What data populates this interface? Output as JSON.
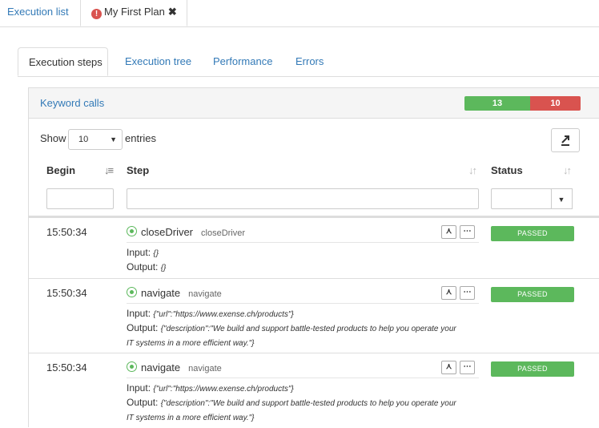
{
  "top_tabs": [
    {
      "label": "Execution list"
    },
    {
      "label": "My First Plan",
      "close": "✖"
    }
  ],
  "sub_tabs": [
    {
      "label": "Execution steps"
    },
    {
      "label": "Execution tree"
    },
    {
      "label": "Performance"
    },
    {
      "label": "Errors"
    }
  ],
  "panel": {
    "title": "Keyword calls",
    "passed_count": "13",
    "failed_count": "10",
    "show_label": "Show",
    "entries_value": "10",
    "entries_label": "entries"
  },
  "columns": {
    "begin": "Begin",
    "step": "Step",
    "status": "Status"
  },
  "rows": [
    {
      "time": "15:50:34",
      "name": "closeDriver",
      "sub": "closeDriver",
      "input_label": "Input:",
      "input": "{}",
      "output_label": "Output:",
      "output": "{}",
      "status": "PASSED"
    },
    {
      "time": "15:50:34",
      "name": "navigate",
      "sub": "navigate",
      "input_label": "Input:",
      "input": "{\"url\":\"https://www.exense.ch/products\"}",
      "output_label": "Output:",
      "output": "{\"description\":\"We build and support battle-tested products to help you operate your",
      "output2": "IT systems in a more efficient way.\"}",
      "status": "PASSED"
    },
    {
      "time": "15:50:34",
      "name": "navigate",
      "sub": "navigate",
      "input_label": "Input:",
      "input": "{\"url\":\"https://www.exense.ch/products\"}",
      "output_label": "Output:",
      "output": "{\"description\":\"We build and support battle-tested products to help you operate your",
      "output2": "IT systems in a more efficient way.\"}",
      "status": "PASSED"
    }
  ],
  "colors": {
    "passed": "#5cb85c",
    "failed": "#d9534f",
    "link": "#337ab7"
  },
  "icons": [
    "error-icon",
    "close-icon",
    "export-icon",
    "sort-icon",
    "ok-circle-icon",
    "tree-icon",
    "ellipsis-icon"
  ]
}
